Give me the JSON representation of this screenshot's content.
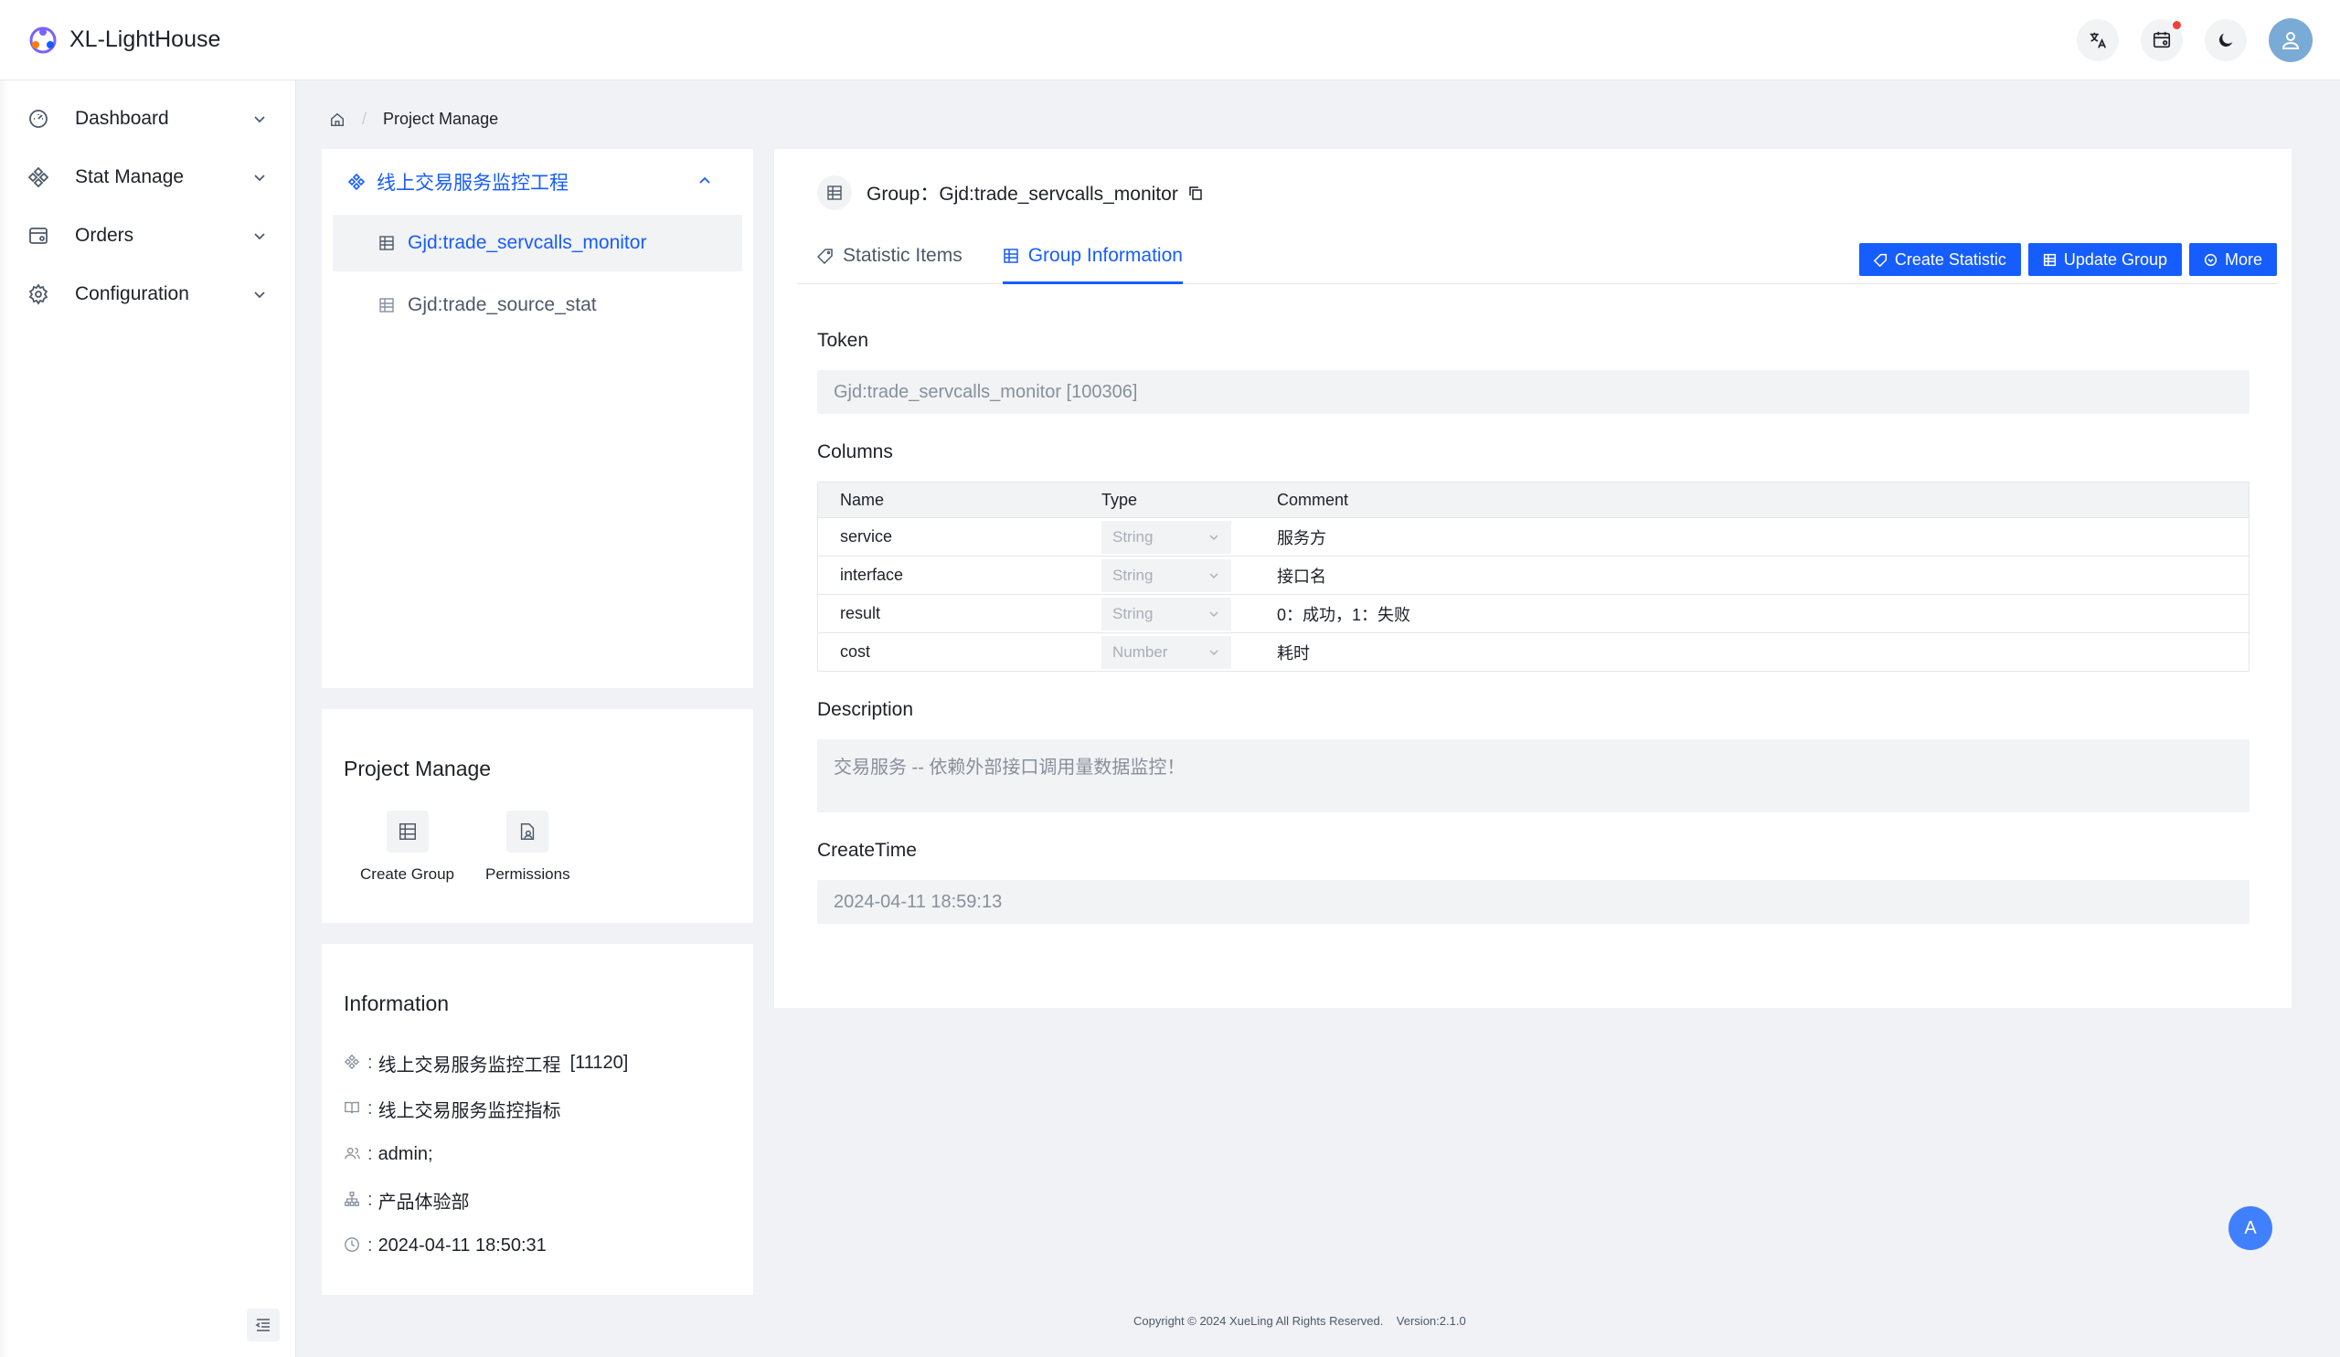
{
  "app": {
    "title": "XL-LightHouse"
  },
  "header": {
    "icons": [
      "translate-icon",
      "calendar-icon",
      "moon-icon",
      "user-icon"
    ]
  },
  "sidebar": {
    "items": [
      {
        "label": "Dashboard",
        "icon": "dashboard-icon"
      },
      {
        "label": "Stat Manage",
        "icon": "stat-icon"
      },
      {
        "label": "Orders",
        "icon": "orders-icon"
      },
      {
        "label": "Configuration",
        "icon": "gear-icon"
      }
    ]
  },
  "breadcrumb": {
    "current": "Project Manage"
  },
  "tree": {
    "root": "线上交易服务监控工程",
    "leaves": [
      {
        "label": "Gjd:trade_servcalls_monitor",
        "active": true
      },
      {
        "label": "Gjd:trade_source_stat",
        "active": false
      }
    ]
  },
  "project_manage": {
    "title": "Project Manage",
    "actions": [
      {
        "label": "Create Group"
      },
      {
        "label": "Permissions"
      }
    ]
  },
  "information": {
    "title": "Information",
    "colon": ":",
    "project": "线上交易服务监控工程",
    "project_id": "[11120]",
    "desc": "线上交易服务监控指标",
    "users": "admin;",
    "department": "产品体验部",
    "time": "2024-04-11 18:50:31"
  },
  "main": {
    "group_title": "Group：Gjd:trade_servcalls_monitor",
    "tabs": [
      {
        "label": "Statistic Items",
        "active": false
      },
      {
        "label": "Group Information",
        "active": true
      }
    ],
    "buttons": {
      "create": "Create Statistic",
      "update": "Update Group",
      "more": "More"
    },
    "token_label": "Token",
    "token_value": "Gjd:trade_servcalls_monitor [100306]",
    "columns_label": "Columns",
    "columns_header": {
      "name": "Name",
      "type": "Type",
      "comment": "Comment"
    },
    "columns": [
      {
        "name": "service",
        "type": "String",
        "comment": "服务方"
      },
      {
        "name": "interface",
        "type": "String",
        "comment": "接口名"
      },
      {
        "name": "result",
        "type": "String",
        "comment": "0：成功，1：失败"
      },
      {
        "name": "cost",
        "type": "Number",
        "comment": "耗时"
      }
    ],
    "description_label": "Description",
    "description_value": "交易服务 -- 依赖外部接口调用量数据监控！",
    "createtime_label": "CreateTime",
    "createtime_value": "2024-04-11 18:59:13"
  },
  "footer": {
    "text": "Copyright © 2024 XueLing All Rights Reserved.    Version:2.1.0"
  },
  "float_button": {
    "label": "A"
  },
  "colors": {
    "primary": "#165dff",
    "bg": "#f1f2f5"
  }
}
